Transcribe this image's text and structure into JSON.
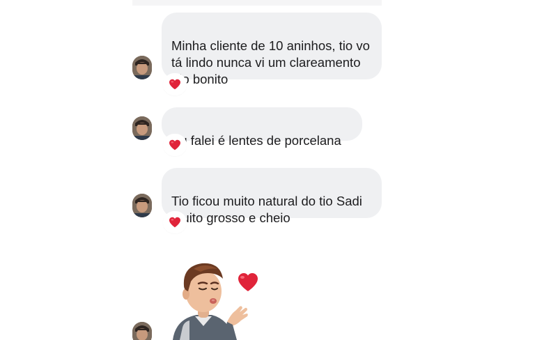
{
  "conversation": {
    "messages": [
      {
        "text": "Minha cliente de 10 aninhos, tio vo\ntá lindo nunca vi um clareamento\ntão bonito",
        "reaction": "heart-reaction"
      },
      {
        "text": "Eu falei é lentes de porcelana",
        "reaction": "heart-reaction"
      },
      {
        "text": "Tio ficou muito natural do tio Sadi\nmuito grosso e cheio",
        "reaction": "heart-reaction"
      }
    ],
    "sticker": {
      "icon": "blowing-kiss-avatar-sticker"
    }
  },
  "colors": {
    "bubble": "#eff0f2",
    "heart": "#e0243a",
    "text": "#1c1c1e"
  }
}
